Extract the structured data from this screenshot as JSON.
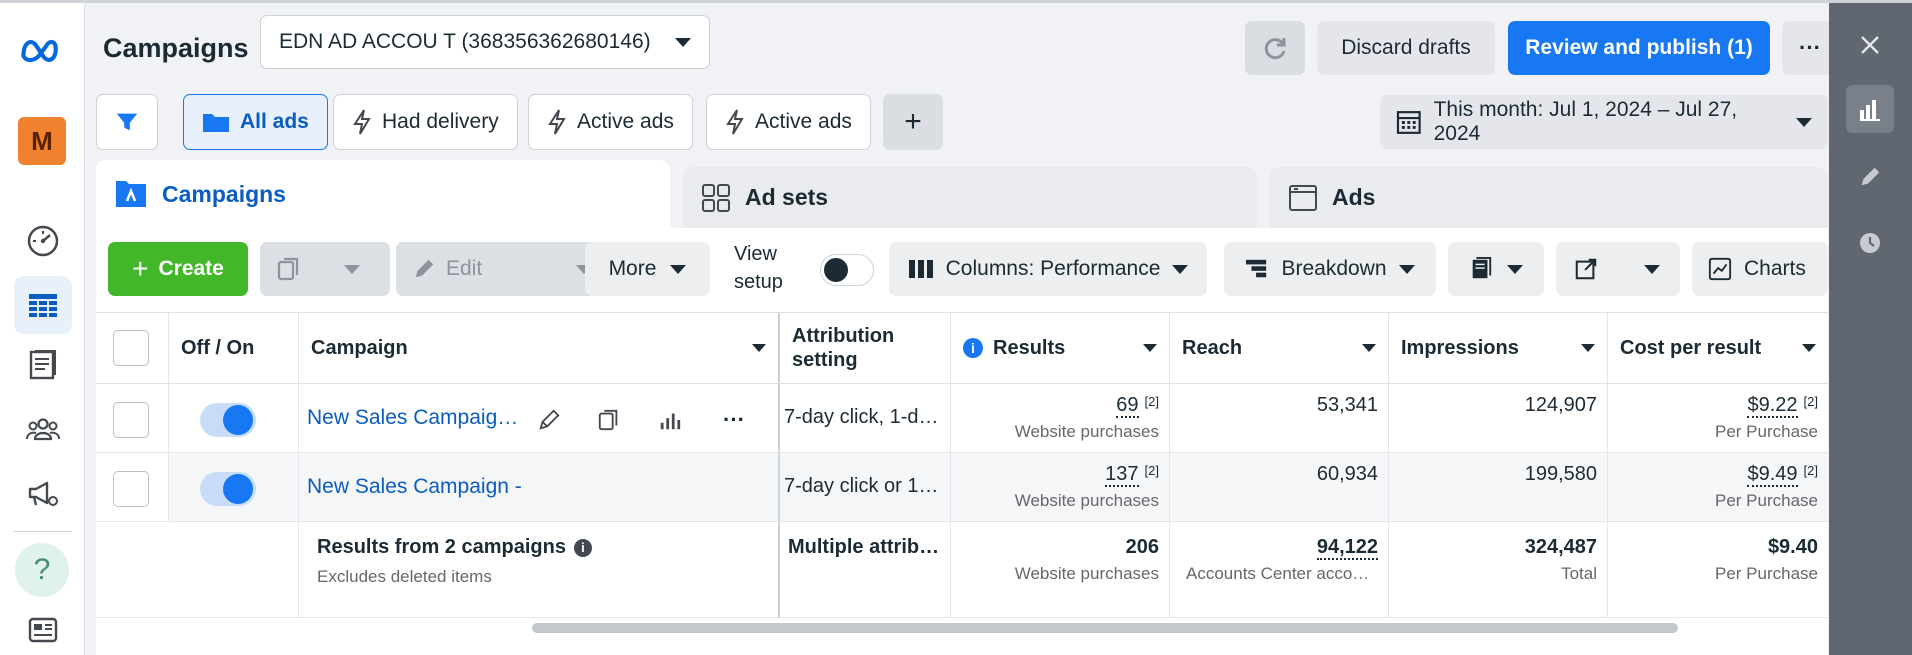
{
  "header": {
    "title": "Campaigns",
    "account": "EDN AD ACCOU T (368356362680146)",
    "discard_label": "Discard drafts",
    "publish_label": "Review and publish (1)",
    "more_label": "···"
  },
  "filters": {
    "chips": [
      "All ads",
      "Had delivery",
      "Active ads",
      "Active ads"
    ],
    "plus": "+",
    "date_range": "This month: Jul 1, 2024 – Jul 27, 2024"
  },
  "tabs": [
    "Campaigns",
    "Ad sets",
    "Ads"
  ],
  "toolbar": {
    "create": "Create",
    "edit": "Edit",
    "more": "More",
    "view_setup_line1": "View",
    "view_setup_line2": "setup",
    "columns": "Columns: Performance",
    "breakdown": "Breakdown",
    "charts": "Charts"
  },
  "table": {
    "headers": {
      "offon": "Off / On",
      "campaign": "Campaign",
      "attribution_1": "Attribution",
      "attribution_2": "setting",
      "results": "Results",
      "reach": "Reach",
      "impressions": "Impressions",
      "cost": "Cost per result"
    },
    "rows": [
      {
        "name": "New Sales Campaig…",
        "attribution": "7-day click, 1-d…",
        "results": "69",
        "results_sup": "[2]",
        "results_sub": "Website purchases",
        "reach": "53,341",
        "impressions": "124,907",
        "cost": "$9.22",
        "cost_sup": "[2]",
        "cost_sub": "Per Purchase"
      },
      {
        "name": "New Sales Campaign -",
        "attribution": "7-day click or 1…",
        "results": "137",
        "results_sup": "[2]",
        "results_sub": "Website purchases",
        "reach": "60,934",
        "impressions": "199,580",
        "cost": "$9.49",
        "cost_sup": "[2]",
        "cost_sub": "Per Purchase"
      }
    ],
    "summary": {
      "title": "Results from 2 campaigns",
      "subtitle": "Excludes deleted items",
      "attribution": "Multiple attrib…",
      "results": "206",
      "results_sub": "Website purchases",
      "reach": "94,122",
      "reach_sub": "Accounts Center acco…",
      "impressions": "324,487",
      "impressions_sub": "Total",
      "cost": "$9.40",
      "cost_sub": "Per Purchase"
    }
  },
  "nav": {
    "avatar_letter": "M",
    "help": "?"
  },
  "colors": {
    "brand_blue": "#1877f2",
    "create_green": "#42b72a",
    "avatar_orange": "#f0822f"
  }
}
